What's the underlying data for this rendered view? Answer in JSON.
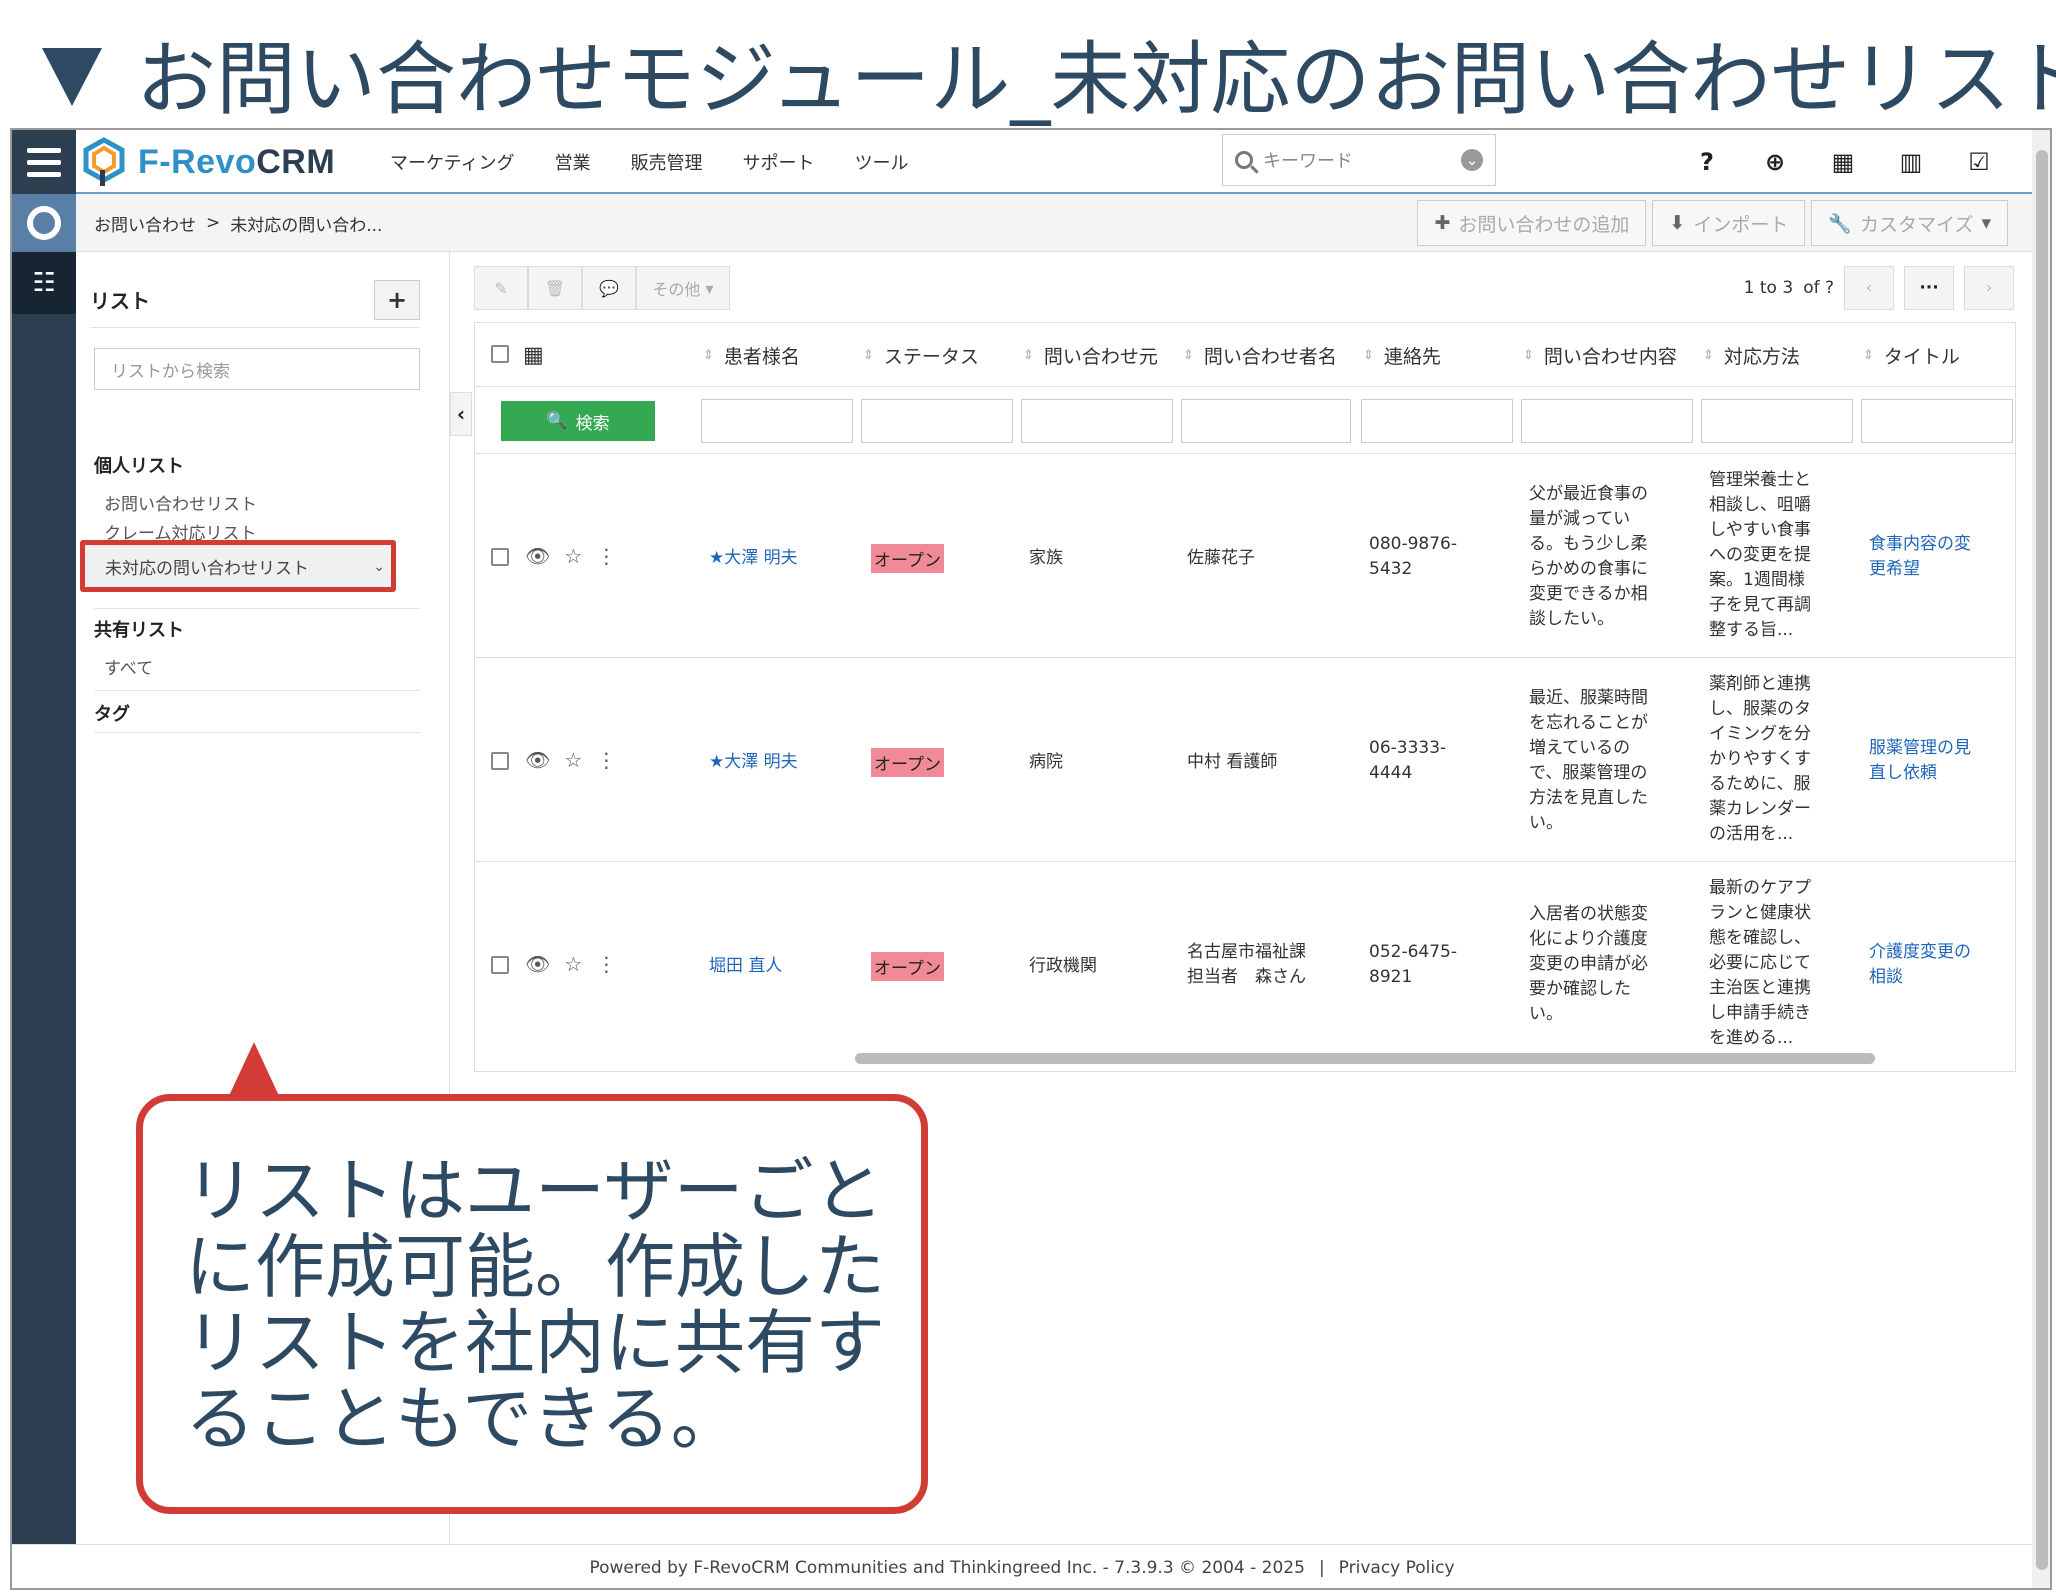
{
  "slide": {
    "title": "お問い合わせモジュール_未対応のお問い合わせリスト"
  },
  "app": {
    "logo_prefix": "F-Revo",
    "logo_suffix": "CRM"
  },
  "topnav": {
    "menu": [
      "マーケティング",
      "営業",
      "販売管理",
      "サポート",
      "ツール"
    ],
    "search_placeholder": "キーワード",
    "tools": [
      "help-icon",
      "add-icon",
      "calendar-icon",
      "chart-icon",
      "tasks-icon",
      "user-icon"
    ]
  },
  "breadcrumb": {
    "module": "お問い合わせ",
    "sep": ">",
    "current": "未対応の問い合わ..."
  },
  "actions": {
    "add": "お問い合わせの追加",
    "import": "インポート",
    "customize": "カスタマイズ"
  },
  "sidebar": {
    "title": "リスト",
    "search_placeholder": "リストから検索",
    "personal_label": "個人リスト",
    "personal_items": [
      "お問い合わせリスト",
      "クレーム対応リスト",
      "未対応の問い合わせリスト"
    ],
    "shared_label": "共有リスト",
    "shared_items": [
      "すべて"
    ],
    "tags_label": "タグ"
  },
  "toolbar": {
    "more": "その他"
  },
  "pager": {
    "range": "1 to 3",
    "of": "of ?"
  },
  "table": {
    "search_button": "検索",
    "columns": [
      "患者様名",
      "ステータス",
      "問い合わせ元",
      "問い合わせ者名",
      "連絡先",
      "問い合わせ内容",
      "対応方法",
      "タイトル"
    ],
    "rows": [
      {
        "patient": "★大澤 明夫",
        "status": "オープン",
        "source": "家族",
        "inquirer": [
          "佐藤花子"
        ],
        "contact": [
          "080-9876-",
          "5432"
        ],
        "content": [
          "父が最近食事の",
          "量が減ってい",
          "る。もう少し柔",
          "らかめの食事に",
          "変更できるか相",
          "談したい。"
        ],
        "method": [
          "管理栄養士と",
          "相談し、咀嚼",
          "しやすい食事",
          "への変更を提",
          "案。1週間様",
          "子を見て再調",
          "整する旨..."
        ],
        "title": [
          "食事内容の変",
          "更希望"
        ]
      },
      {
        "patient": "★大澤 明夫",
        "status": "オープン",
        "source": "病院",
        "inquirer": [
          "中村 看護師"
        ],
        "contact": [
          "06-3333-",
          "4444"
        ],
        "content": [
          "最近、服薬時間",
          "を忘れることが",
          "増えているの",
          "で、服薬管理の",
          "方法を見直した",
          "い。"
        ],
        "method": [
          "薬剤師と連携",
          "し、服薬のタ",
          "イミングを分",
          "かりやすくす",
          "るために、服",
          "薬カレンダー",
          "の活用を..."
        ],
        "title": [
          "服薬管理の見",
          "直し依頼"
        ]
      },
      {
        "patient": "堀田 直人",
        "status": "オープン",
        "source": "行政機関",
        "inquirer": [
          "名古屋市福祉課",
          "担当者　森さん"
        ],
        "contact": [
          "052-6475-",
          "8921"
        ],
        "content": [
          "入居者の状態変",
          "化により介護度",
          "変更の申請が必",
          "要か確認した",
          "い。"
        ],
        "method": [
          "最新のケアプ",
          "ランと健康状",
          "態を確認し、",
          "必要に応じて",
          "主治医と連携",
          "し申請手続き",
          "を進める..."
        ],
        "title": [
          "介護度変更の",
          "相談"
        ]
      }
    ]
  },
  "footer": {
    "powered": "Powered by F-RevoCRM Communities and Thinkingreed Inc. - 7.3.9.3  © 2004 - 2025",
    "sep": "|",
    "privacy": "Privacy Policy"
  },
  "callout": {
    "text": "リストはユーザーごとに作成可能。作成したリストを社内に共有することもできる。"
  },
  "colors": {
    "accent": "#2f8fc6",
    "rail": "#2d3e50",
    "highlight": "#d23b36",
    "status": "#f08a96",
    "search_button": "#34a853"
  }
}
